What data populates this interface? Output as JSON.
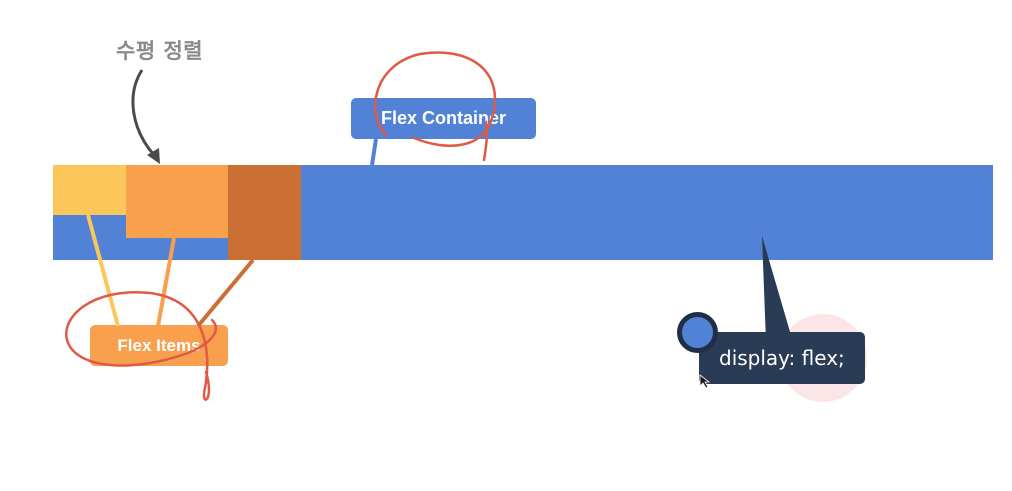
{
  "diagram": {
    "title": "수평 정렬",
    "container_label": "Flex Container",
    "items_label": "Flex Items",
    "code_label": "display: flex;"
  },
  "colors": {
    "container": "#5182d5",
    "item_1": "#fbc75a",
    "item_2": "#f8a04e",
    "item_3": "#cb7035",
    "code_bg": "#2a3b55",
    "annotation_ink": "#e05a45"
  },
  "icons": [
    "curved-arrow-icon",
    "mouse-cursor-icon"
  ]
}
